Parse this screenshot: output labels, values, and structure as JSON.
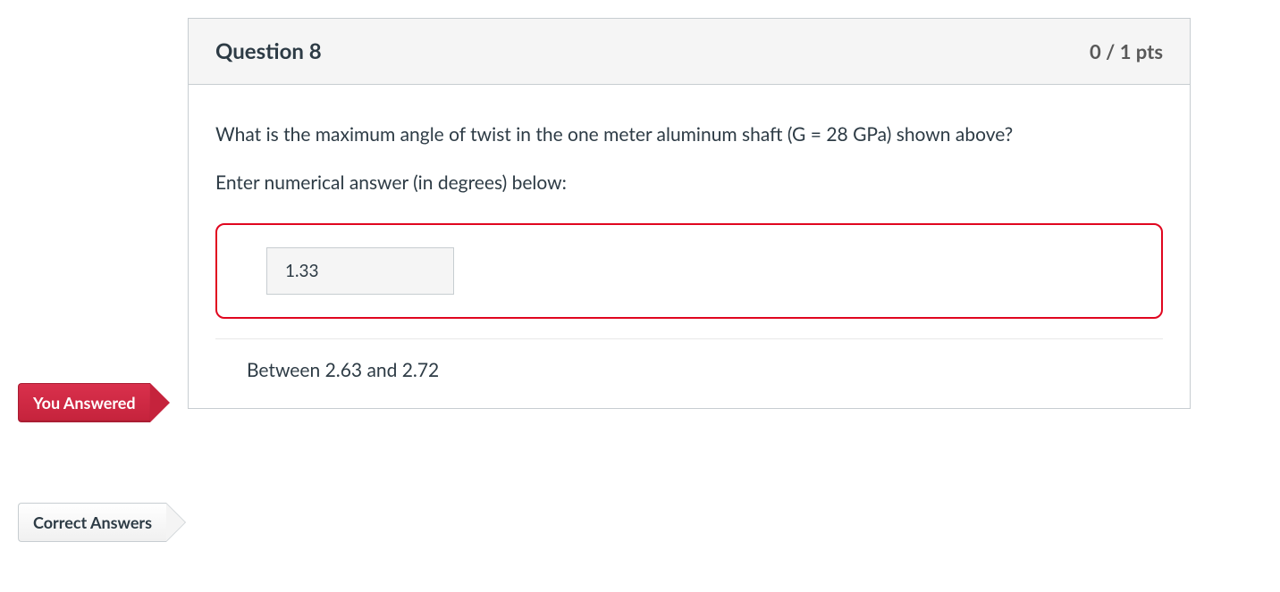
{
  "question": {
    "title": "Question 8",
    "points": "0 / 1 pts",
    "text": "What is the maximum angle of twist in the one meter aluminum shaft (G = 28 GPa) shown above?",
    "prompt": "Enter numerical answer (in degrees) below:"
  },
  "flags": {
    "you_answered": "You Answered",
    "correct_answers": "Correct Answers"
  },
  "answers": {
    "user_answer": "1.33",
    "correct_answer": "Between 2.63 and 2.72"
  }
}
